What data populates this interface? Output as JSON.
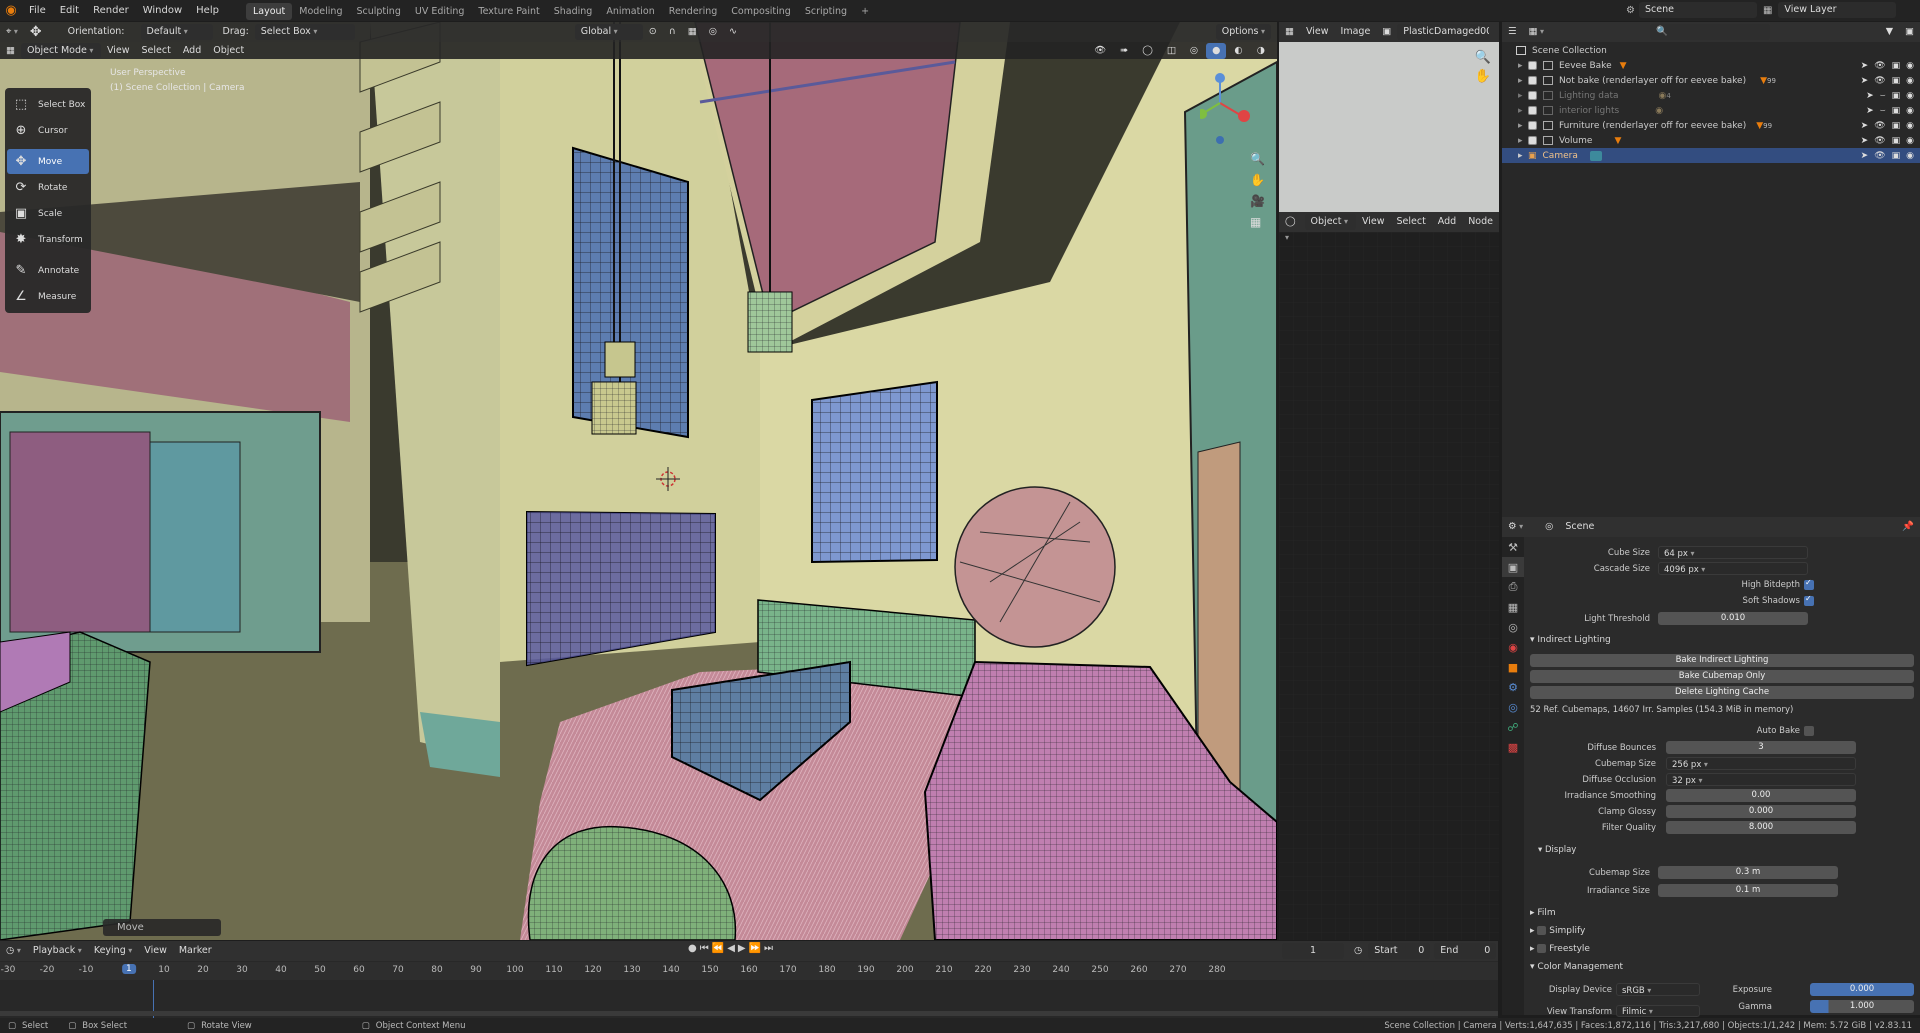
{
  "topbar": {
    "menus": [
      "File",
      "Edit",
      "Render",
      "Window",
      "Help"
    ],
    "workspaces": [
      "Layout",
      "Modeling",
      "Sculpting",
      "UV Editing",
      "Texture Paint",
      "Shading",
      "Animation",
      "Rendering",
      "Compositing",
      "Scripting"
    ],
    "add_tab": "+",
    "scene": "Scene",
    "view_layer": "View Layer"
  },
  "tool_header": {
    "orientation_label": "Orientation:",
    "orientation_value": "Default",
    "drag_label": "Drag:",
    "drag_value": "Select Box",
    "transform_orientation": "Global",
    "options": "Options"
  },
  "viewport_header": {
    "mode": "Object Mode",
    "menus": [
      "View",
      "Select",
      "Add",
      "Object"
    ]
  },
  "viewport": {
    "perspective": "User Perspective",
    "collection": "(1) Scene Collection | Camera",
    "last_operator": "Move"
  },
  "toolbar": [
    {
      "label": "Select Box",
      "icon": "select-box-icon",
      "active": false
    },
    {
      "label": "Cursor",
      "icon": "cursor-icon",
      "active": false
    },
    {
      "label": "Move",
      "icon": "move-icon",
      "active": true
    },
    {
      "label": "Rotate",
      "icon": "rotate-icon",
      "active": false
    },
    {
      "label": "Scale",
      "icon": "scale-icon",
      "active": false
    },
    {
      "label": "Transform",
      "icon": "transform-icon",
      "active": false
    },
    {
      "label": "Annotate",
      "icon": "annotate-icon",
      "active": false
    },
    {
      "label": "Measure",
      "icon": "measure-icon",
      "active": false
    }
  ],
  "image_editor": {
    "menus": [
      "View",
      "Image"
    ],
    "image_name": "PlasticDamaged00..."
  },
  "node_editor": {
    "type": "Object",
    "menus": [
      "View",
      "Select",
      "Add",
      "Node"
    ]
  },
  "outliner": {
    "root": "Scene Collection",
    "items": [
      {
        "name": "Eevee Bake",
        "dim": false,
        "selected": false
      },
      {
        "name": "Not bake (renderlayer off for eevee bake)",
        "dim": false,
        "selected": false,
        "badge": "99"
      },
      {
        "name": "Lighting data",
        "dim": true,
        "selected": false,
        "badge": "4"
      },
      {
        "name": "interior lights",
        "dim": true,
        "selected": false
      },
      {
        "name": "Furniture (renderlayer off for eevee bake)",
        "dim": false,
        "selected": false,
        "badge": "99"
      },
      {
        "name": "Volume",
        "dim": false,
        "selected": false
      },
      {
        "name": "Camera",
        "dim": false,
        "selected": true
      }
    ]
  },
  "properties": {
    "context": "Scene",
    "cube_size_label": "Cube Size",
    "cube_size": "64 px",
    "cascade_size_label": "Cascade Size",
    "cascade_size": "4096 px",
    "high_bitdepth": "High Bitdepth",
    "soft_shadows": "Soft Shadows",
    "light_threshold_label": "Light Threshold",
    "light_threshold": "0.010",
    "indirect_lighting": "Indirect Lighting",
    "bake_indirect": "Bake Indirect Lighting",
    "bake_cubemap": "Bake Cubemap Only",
    "delete_cache": "Delete Lighting Cache",
    "cache_info": "52 Ref. Cubemaps, 14607 Irr. Samples (154.3 MiB in memory)",
    "auto_bake": "Auto Bake",
    "diffuse_bounces_label": "Diffuse Bounces",
    "diffuse_bounces": "3",
    "cubemap_size_label": "Cubemap Size",
    "cubemap_size": "256 px",
    "diffuse_occlusion_label": "Diffuse Occlusion",
    "diffuse_occlusion": "32 px",
    "irradiance_smoothing_label": "Irradiance Smoothing",
    "irradiance_smoothing": "0.00",
    "clamp_glossy_label": "Clamp Glossy",
    "clamp_glossy": "0.000",
    "filter_quality_label": "Filter Quality",
    "filter_quality": "8.000",
    "display": "Display",
    "display_cubemap_size_label": "Cubemap Size",
    "display_cubemap_size": "0.3 m",
    "irradiance_size_label": "Irradiance Size",
    "irradiance_size": "0.1 m",
    "film": "Film",
    "simplify": "Simplify",
    "freestyle": "Freestyle",
    "color_management": "Color Management",
    "display_device_label": "Display Device",
    "display_device": "sRGB",
    "view_transform_label": "View Transform",
    "view_transform": "Filmic",
    "exposure_label": "Exposure",
    "exposure": "0.000",
    "gamma_label": "Gamma",
    "gamma": "1.000"
  },
  "timeline": {
    "menus": [
      "Playback",
      "Keying",
      "View",
      "Marker"
    ],
    "current_frame": "1",
    "start_label": "Start",
    "start": "0",
    "end_label": "End",
    "end": "0",
    "ticks": [
      "-30",
      "-20",
      "-10",
      "1",
      "10",
      "20",
      "30",
      "40",
      "50",
      "60",
      "70",
      "80",
      "90",
      "100",
      "110",
      "120",
      "130",
      "140",
      "150",
      "160",
      "170",
      "180",
      "190",
      "200",
      "210",
      "220",
      "230",
      "240",
      "250",
      "260",
      "270",
      "280"
    ]
  },
  "statusbar": {
    "select": "Select",
    "box_select": "Box Select",
    "rotate_view": "Rotate View",
    "context_menu": "Object Context Menu",
    "stats": "Scene Collection | Camera | Verts:1,647,635 | Faces:1,872,116 | Tris:3,217,680 | Objects:1/1,242 | Mem: 5.72 GiB | v2.83.11"
  }
}
